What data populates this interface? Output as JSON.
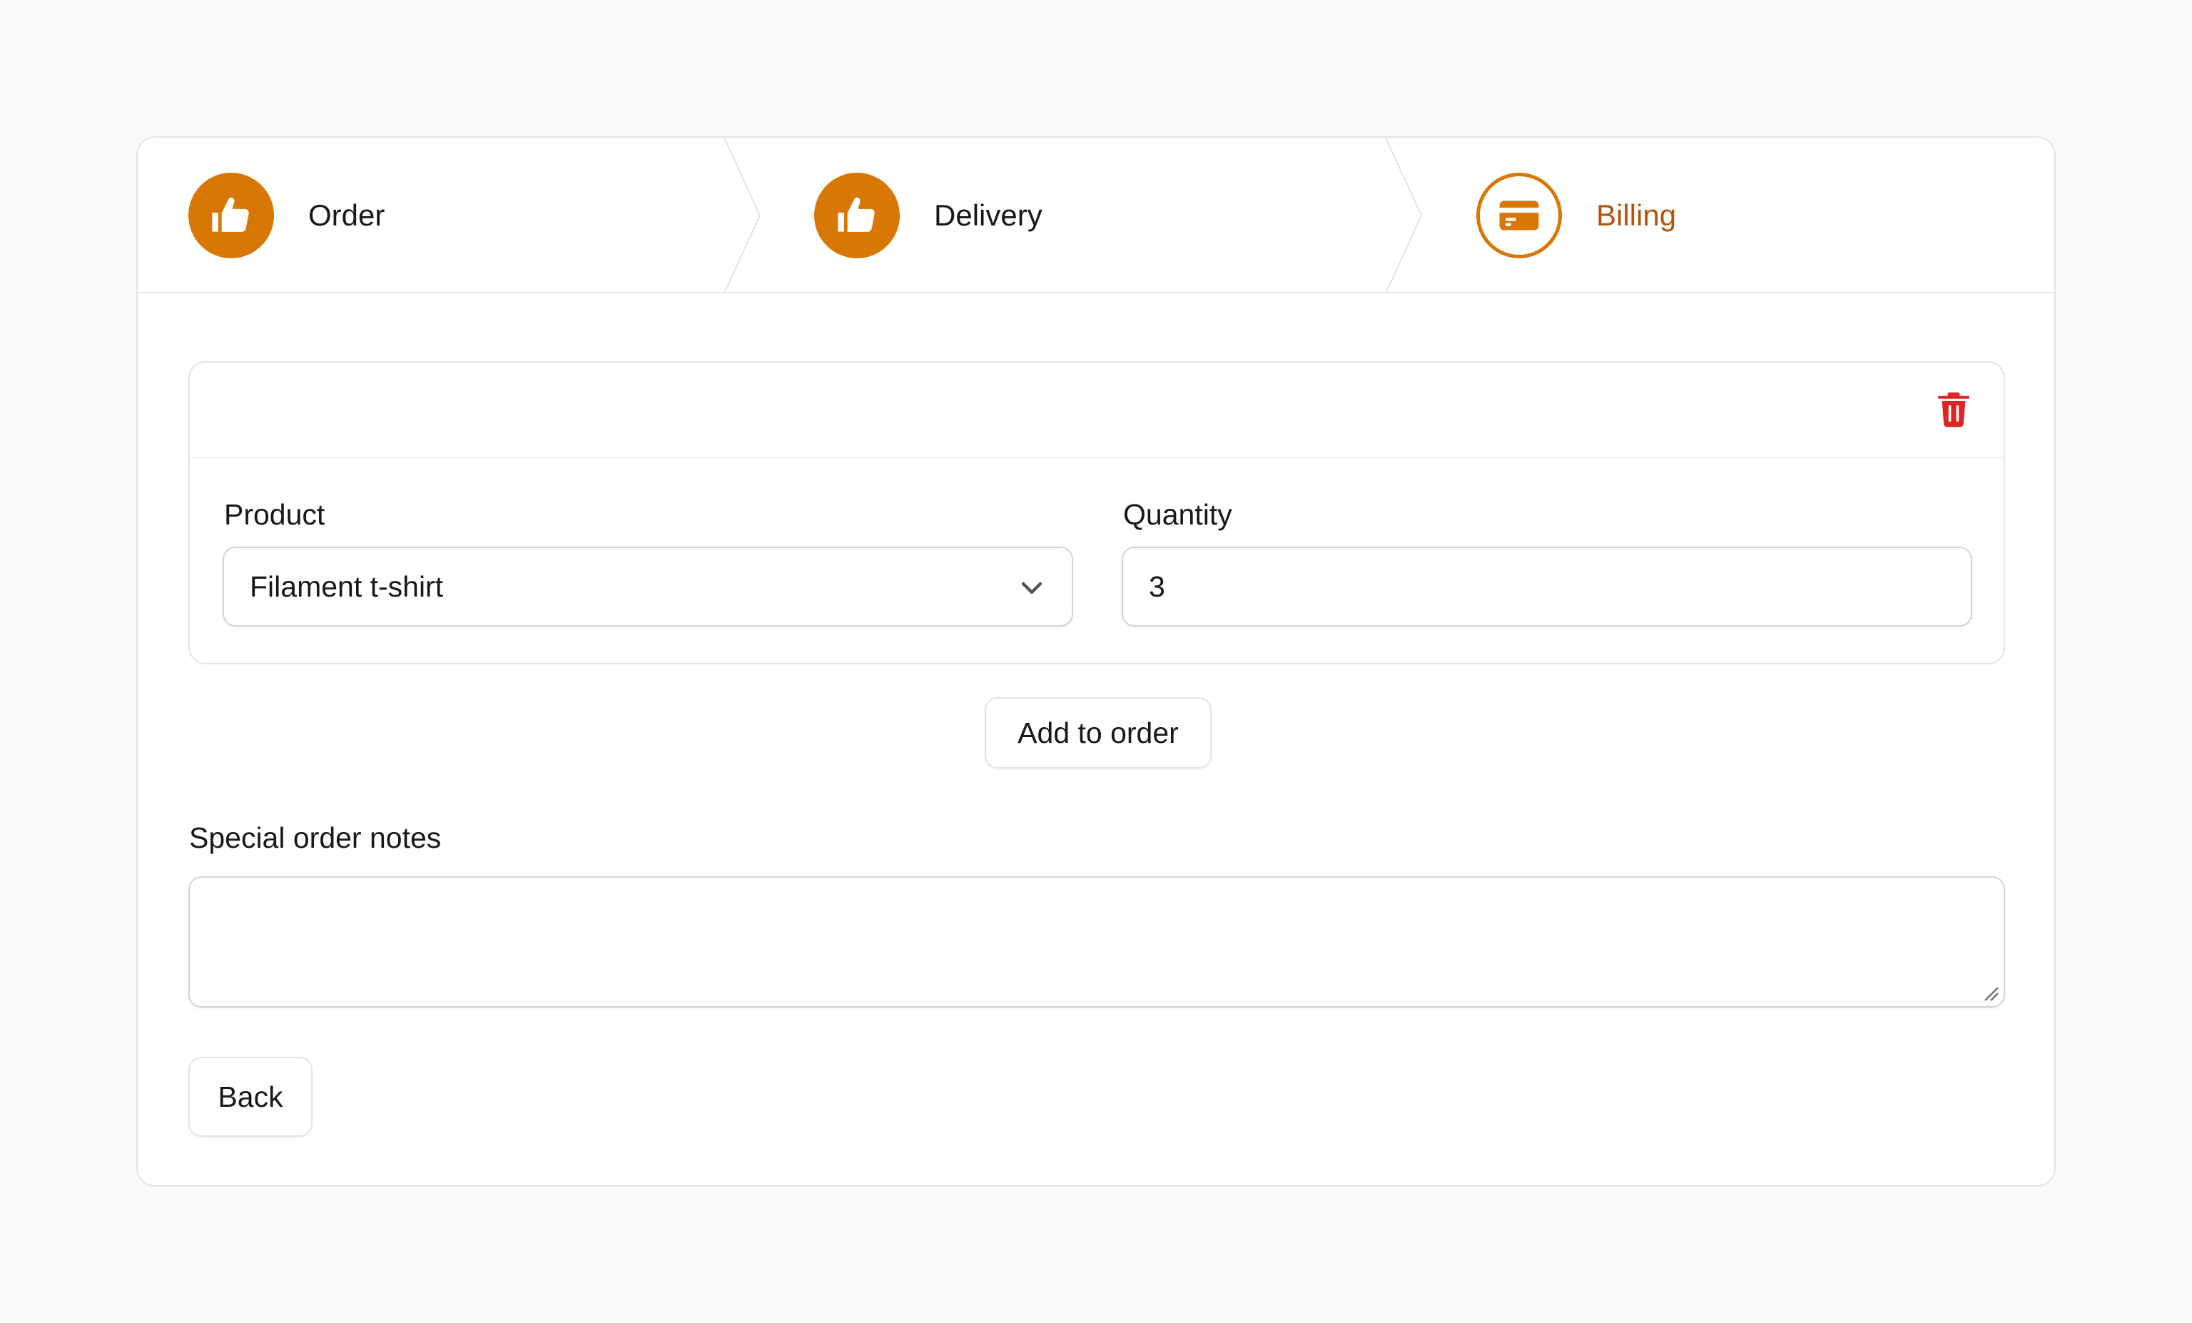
{
  "wizard": {
    "steps": [
      {
        "label": "Order",
        "state": "complete",
        "icon": "thumbs-up-icon"
      },
      {
        "label": "Delivery",
        "state": "complete",
        "icon": "thumbs-up-icon"
      },
      {
        "label": "Billing",
        "state": "current",
        "icon": "credit-card-icon"
      }
    ]
  },
  "order_items": {
    "delete_icon": "trash-icon",
    "items": [
      {
        "product_label": "Product",
        "product_value": "Filament t-shirt",
        "quantity_label": "Quantity",
        "quantity_value": "3"
      }
    ],
    "add_button_label": "Add to order"
  },
  "notes": {
    "label": "Special order notes",
    "value": ""
  },
  "footer": {
    "back_label": "Back"
  },
  "colors": {
    "accent": "#d97706",
    "accent_text": "#b45309",
    "danger": "#dc2626",
    "border": "#e4e4e7",
    "background": "#fafafa"
  }
}
